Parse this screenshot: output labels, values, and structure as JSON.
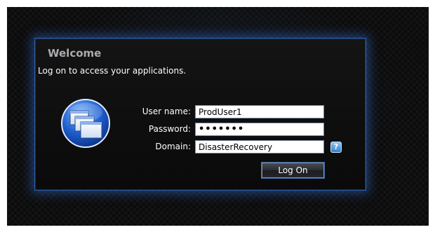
{
  "dialog": {
    "title": "Welcome",
    "subtitle": "Log on to access your applications."
  },
  "form": {
    "username_label": "User name:",
    "username_value": "ProdUser1",
    "password_label": "Password:",
    "password_value": "•••••••",
    "domain_label": "Domain:",
    "domain_value": "DisasterRecovery",
    "logon_label": "Log On",
    "help_glyph": "?"
  },
  "icons": {
    "app_icon": "windows-stack-icon",
    "help_icon": "help-icon"
  },
  "colors": {
    "accent": "#2c5fa8",
    "background": "#0c0c0d",
    "title_text": "#a9abae"
  }
}
